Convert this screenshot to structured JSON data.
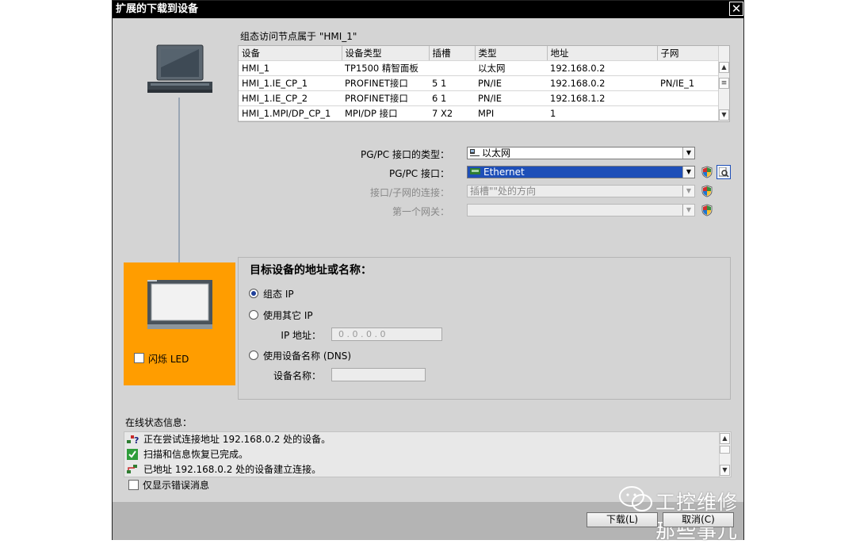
{
  "dialog": {
    "title": "扩展的下载到设备",
    "close_symbol": "✕"
  },
  "devices_table": {
    "caption": "组态访问节点属于 \"HMI_1\"",
    "columns": [
      "设备",
      "设备类型",
      "插槽",
      "类型",
      "地址",
      "子网"
    ],
    "rows": [
      [
        "HMI_1",
        "TP1500 精智面板",
        "",
        "以太网",
        "192.168.0.2",
        ""
      ],
      [
        "HMI_1.IE_CP_1",
        "PROFINET接口",
        "5 1",
        "PN/IE",
        "192.168.0.2",
        "PN/IE_1"
      ],
      [
        "HMI_1.IE_CP_2",
        "PROFINET接口",
        "6 1",
        "PN/IE",
        "192.168.1.2",
        ""
      ],
      [
        "HMI_1.MPI/DP_CP_1",
        "MPI/DP 接口",
        "7 X2",
        "MPI",
        "1",
        ""
      ]
    ]
  },
  "connection": {
    "pgpc_type_label": "PG/PC 接口的类型：",
    "pgpc_type_value": "以太网",
    "pgpc_iface_label": "PG/PC 接口：",
    "pgpc_iface_value": "Ethernet",
    "subnet_label": "接口/子网的连接：",
    "subnet_value": "插槽\"\"处的方向",
    "gateway_label": "第一个网关：",
    "gateway_value": ""
  },
  "target": {
    "heading": "目标设备的地址或名称：",
    "opt_config_ip": "组态 IP",
    "opt_other_ip": "使用其它 IP",
    "ip_label": "IP 地址：",
    "ip_value": "0 . 0 . 0 . 0",
    "opt_dns": "使用设备名称 (DNS)",
    "devname_label": "设备名称：",
    "devname_value": ""
  },
  "device_panel": {
    "flash_led_label": "闪烁 LED"
  },
  "status": {
    "heading": "在线状态信息：",
    "messages": [
      "正在尝试连接地址 192.168.0.2 处的设备。",
      "扫描和信息恢复已完成。",
      "已地址 192.168.0.2 处的设备建立连接。"
    ],
    "errors_only_label": "仅显示错误消息"
  },
  "buttons": {
    "download": "下载(L)",
    "cancel": "取消(C)"
  },
  "watermark": {
    "text": "工控维修那些事儿"
  },
  "colors": {
    "accent_orange": "#ff9d00",
    "selection_blue": "#1e4fb8",
    "title_bar": "#000000"
  }
}
